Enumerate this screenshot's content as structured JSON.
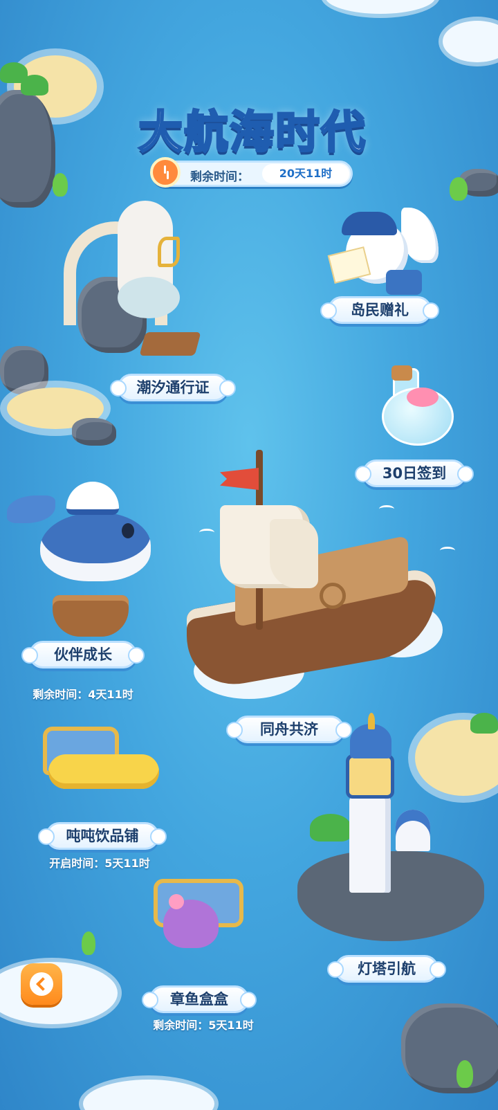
{
  "event": {
    "title": "大航海时代",
    "timer_label": "剩余时间：",
    "timer_value": "20天11时"
  },
  "buildings": {
    "tide_pass": {
      "label": "潮汐通行证"
    },
    "islander_gift": {
      "label": "岛民赠礼"
    },
    "checkin": {
      "label": "30日签到"
    },
    "partner_growth": {
      "label": "伙伴成长",
      "subtext": "剩余时间：4天11时"
    },
    "ship": {
      "label": "同舟共济"
    },
    "drink_shop": {
      "label": "吨吨饮品铺",
      "subtext": "开启时间：5天11时"
    },
    "lighthouse": {
      "label": "灯塔引航"
    },
    "octopus_box": {
      "label": "章鱼盒盒",
      "subtext": "剩余时间：5天11时"
    }
  },
  "icons": {
    "back": "back-arrow-icon",
    "clock": "clock-icon"
  },
  "colors": {
    "ocean": "#43a6df",
    "plate_text": "#1d3f6c",
    "accent_orange": "#ff8a1c"
  }
}
